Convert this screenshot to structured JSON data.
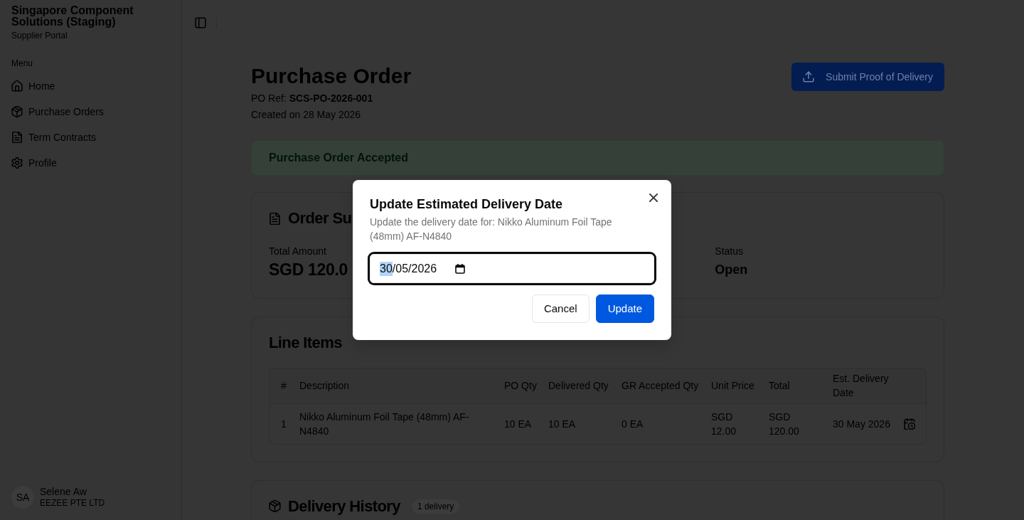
{
  "sidebar": {
    "title": "Singapore Component Solutions (Staging)",
    "subtitle": "Supplier Portal",
    "section_label": "Menu",
    "items": [
      {
        "label": "Home"
      },
      {
        "label": "Purchase Orders"
      },
      {
        "label": "Term Contracts"
      },
      {
        "label": "Profile"
      }
    ],
    "user": {
      "initials": "SA",
      "name": "Selene Aw",
      "company": "EEZEE PTE LTD"
    }
  },
  "header": {
    "title": "Purchase Order",
    "reference": "PO Ref: **SCS-PO-2026-001**",
    "created": "Created on 28 May 2026",
    "action_button": "Submit Proof of Delivery"
  },
  "alert": {
    "text": "Purchase Order Accepted"
  },
  "order_summary": {
    "title": "Order Su",
    "fields": [
      {
        "label": "Total Amount",
        "value": "SGD 120.0",
        "kind": "amount"
      },
      {
        "label": "Status",
        "value": "Open",
        "kind": "text"
      }
    ]
  },
  "line_items": {
    "title": "Line Items",
    "columns": [
      "#",
      "Description",
      "PO Qty",
      "Delivered Qty",
      "GR Accepted Qty",
      "Unit Price",
      "Total",
      "Est. Delivery Date"
    ],
    "rows": [
      {
        "cells": [
          "1",
          "Nikko Aluminum Foil Tape (48mm) AF-N4840",
          "10 EA",
          "10 EA",
          "0 EA",
          "SGD 12.00",
          "SGD 120.00",
          "30 May 2026"
        ]
      }
    ]
  },
  "delivery_history": {
    "title": "Delivery History",
    "badge": "1 delivery"
  },
  "dialog": {
    "title": "Update Estimated Delivery Date",
    "description": "Update the delivery date for: Nikko Aluminum Foil Tape (48mm) AF-N4840",
    "date_input": {
      "value": "30/05/2026",
      "focused": true
    },
    "buttons": [
      {
        "label": "Cancel",
        "kind": "secondary"
      },
      {
        "label": "Update",
        "kind": "primary"
      }
    ]
  }
}
